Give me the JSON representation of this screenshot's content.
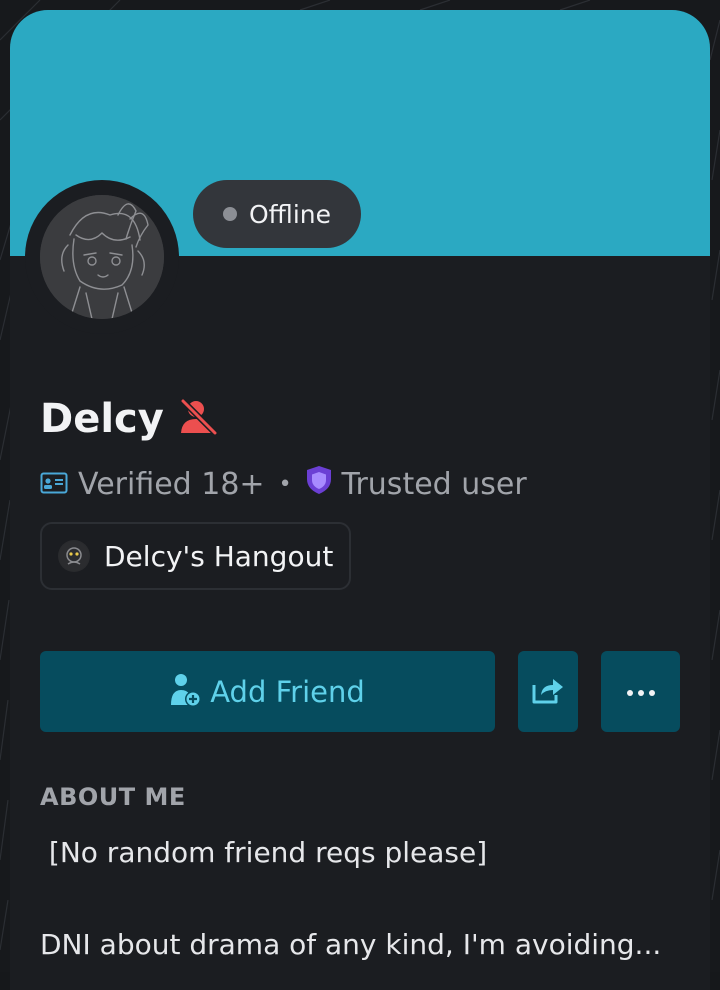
{
  "profile": {
    "status": "Offline",
    "display_name": "Delcy",
    "name_badge_icon": "person-blocked-icon",
    "badges": [
      {
        "label": "Verified 18+",
        "icon": "id-card-icon"
      },
      {
        "label": "Trusted user",
        "icon": "shield-icon"
      }
    ],
    "badge_separator": "•",
    "server": {
      "name": "Delcy's Hangout",
      "icon": "server-avatar-icon"
    }
  },
  "actions": {
    "add_friend_label": "Add Friend",
    "share_icon": "share-icon",
    "more_icon": "more-dots-icon"
  },
  "about": {
    "title": "ABOUT ME",
    "lines": [
      " [No random friend reqs please]",
      "DNI about drama of any kind, I'm avoiding..."
    ]
  },
  "colors": {
    "banner": "#2ba9c2",
    "card_bg": "#1b1d21",
    "button_bg": "#064c5e",
    "button_text": "#5fd1ea",
    "danger_red": "#ec4f4f",
    "shield_purple": "#8a5cf6",
    "status_offline": "#8c8f95"
  }
}
